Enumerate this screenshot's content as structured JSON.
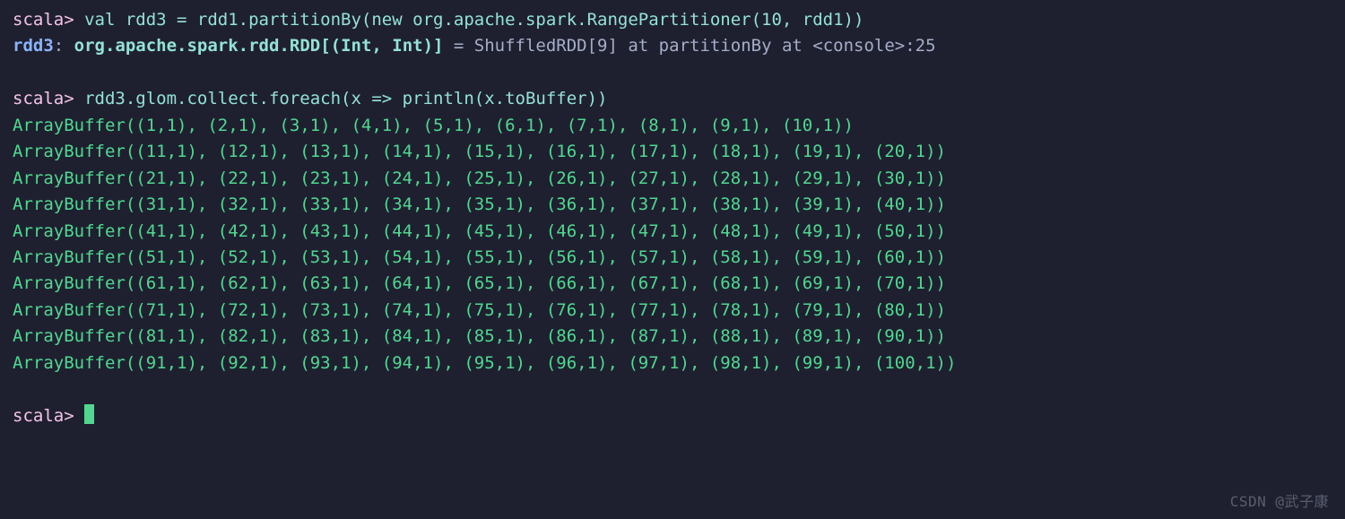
{
  "exchanges": [
    {
      "prompt": "scala> ",
      "input": "val rdd3 = rdd1.partitionBy(new org.apache.spark.RangePartitioner(10, rdd1))",
      "result_var": "rdd3",
      "result_sep": ": ",
      "result_type": "org.apache.spark.rdd.RDD[(Int, Int)]",
      "result_rest": " = ShuffledRDD[9] at partitionBy at <console>:25"
    },
    {
      "prompt": "scala> ",
      "input": "rdd3.glom.collect.foreach(x => println(x.toBuffer))",
      "output": [
        "ArrayBuffer((1,1), (2,1), (3,1), (4,1), (5,1), (6,1), (7,1), (8,1), (9,1), (10,1))",
        "ArrayBuffer((11,1), (12,1), (13,1), (14,1), (15,1), (16,1), (17,1), (18,1), (19,1), (20,1))",
        "ArrayBuffer((21,1), (22,1), (23,1), (24,1), (25,1), (26,1), (27,1), (28,1), (29,1), (30,1))",
        "ArrayBuffer((31,1), (32,1), (33,1), (34,1), (35,1), (36,1), (37,1), (38,1), (39,1), (40,1))",
        "ArrayBuffer((41,1), (42,1), (43,1), (44,1), (45,1), (46,1), (47,1), (48,1), (49,1), (50,1))",
        "ArrayBuffer((51,1), (52,1), (53,1), (54,1), (55,1), (56,1), (57,1), (58,1), (59,1), (60,1))",
        "ArrayBuffer((61,1), (62,1), (63,1), (64,1), (65,1), (66,1), (67,1), (68,1), (69,1), (70,1))",
        "ArrayBuffer((71,1), (72,1), (73,1), (74,1), (75,1), (76,1), (77,1), (78,1), (79,1), (80,1))",
        "ArrayBuffer((81,1), (82,1), (83,1), (84,1), (85,1), (86,1), (87,1), (88,1), (89,1), (90,1))",
        "ArrayBuffer((91,1), (92,1), (93,1), (94,1), (95,1), (96,1), (97,1), (98,1), (99,1), (100,1))"
      ]
    }
  ],
  "final_prompt": "scala> ",
  "watermark": "CSDN @武子康"
}
